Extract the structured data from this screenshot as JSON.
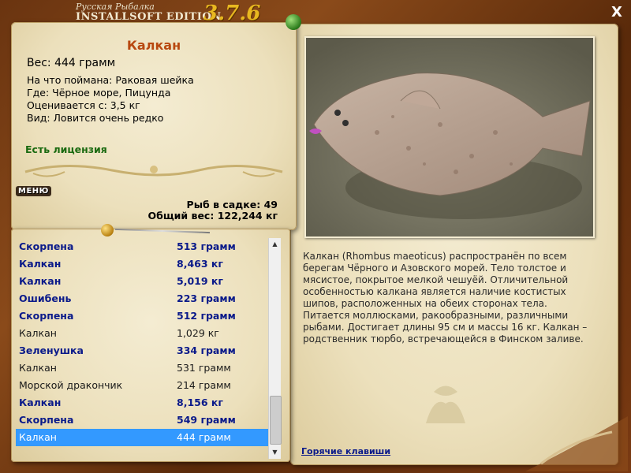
{
  "app": {
    "title_top": "Русская Рыбалка",
    "title_main": "INSTALLSOFT EDITION",
    "version": "3.7.6",
    "close_label": "X"
  },
  "fish": {
    "name": "Калкан",
    "weight_text": "Вес: 444 грамм",
    "bait_text": "На что поймана: Раковая шейка",
    "place_text": "Где: Чёрное море, Пицунда",
    "trophy_text": "Оценивается с: 3,5 кг",
    "rarity_text": "Вид: Ловится очень редко",
    "license_text": "Есть лицензия"
  },
  "stats": {
    "count_text": "Рыб в садке: 49",
    "total_text": "Общий вес: 122,244 кг"
  },
  "menu_label": "МЕНЮ",
  "catch_list": [
    {
      "name": "Скорпена",
      "weight": "513 грамм",
      "style": "bold"
    },
    {
      "name": "Калкан",
      "weight": "8,463 кг",
      "style": "bold"
    },
    {
      "name": "Калкан",
      "weight": "5,019 кг",
      "style": "bold"
    },
    {
      "name": "Ошибень",
      "weight": "223 грамм",
      "style": "bold"
    },
    {
      "name": "Скорпена",
      "weight": "512 грамм",
      "style": "bold"
    },
    {
      "name": "Калкан",
      "weight": "1,029 кг",
      "style": "normal"
    },
    {
      "name": "Зеленушка",
      "weight": "334 грамм",
      "style": "bold"
    },
    {
      "name": "Калкан",
      "weight": "531 грамм",
      "style": "normal"
    },
    {
      "name": "Морской дракончик",
      "weight": "214 грамм",
      "style": "normal"
    },
    {
      "name": "Калкан",
      "weight": "8,156 кг",
      "style": "bold"
    },
    {
      "name": "Скорпена",
      "weight": "549 грамм",
      "style": "bold"
    },
    {
      "name": "Калкан",
      "weight": "444 грамм",
      "style": "selected"
    }
  ],
  "description": "Калкан (Rhombus maeoticus) распространён по всем берегам Чёрного и Азовского морей. Тело толстое и мясистое, покрытое мелкой чешуёй. Отличительной особенностью калкана является наличие костистых шипов, расположенных на обеих сторонах тела. Питается моллюсками, ракообразными, различными рыбами. Достигает длины 95 см и массы 16 кг. Калкан – родственник тюрбо, встречающейся в Финском заливе.",
  "hotkeys_label": "Горячие клавиши",
  "colors": {
    "fish_title": "#b84810",
    "license": "#1a6a10",
    "list_bold": "#0a1a8a",
    "selection": "#3399ff",
    "version": "#e8b820"
  }
}
